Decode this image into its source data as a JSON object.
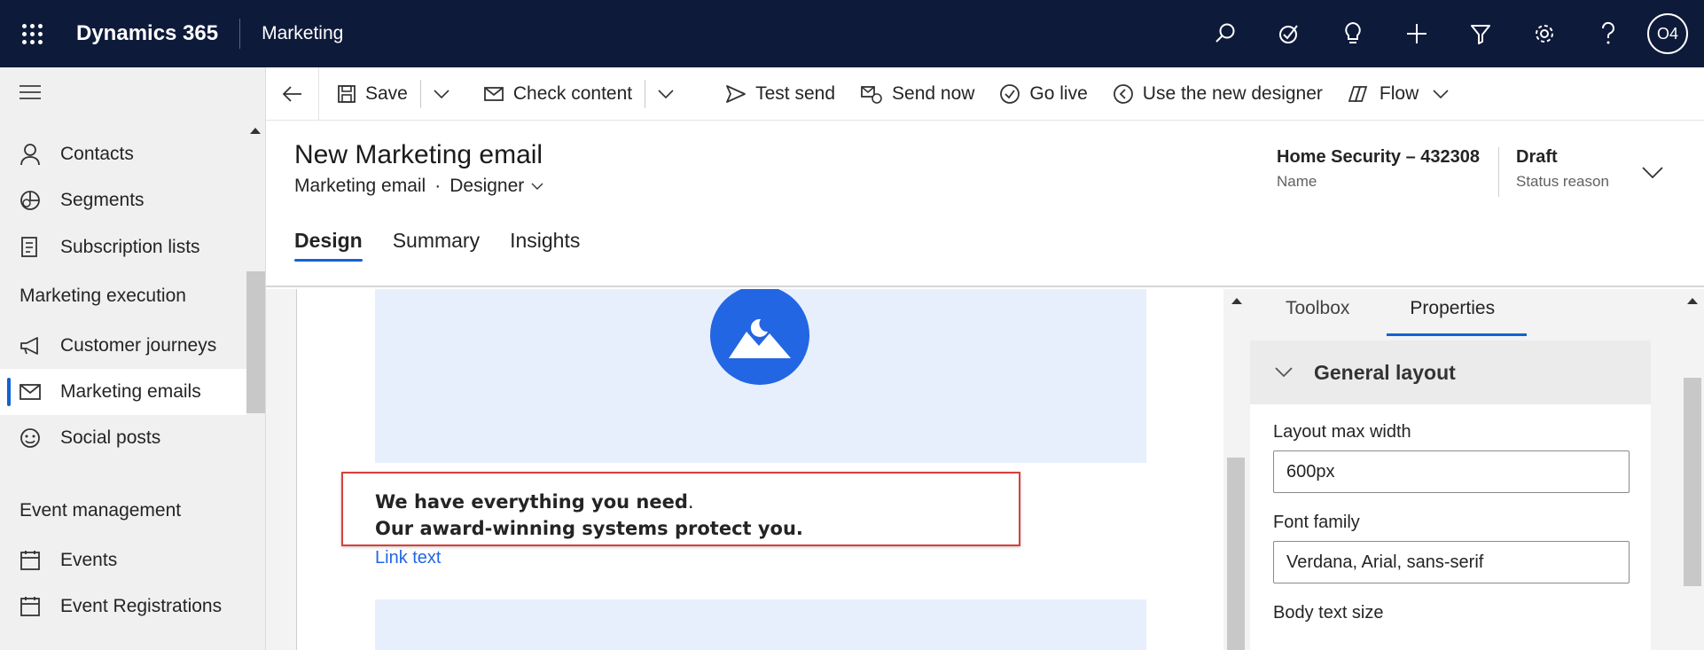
{
  "topbar": {
    "app_title": "Dynamics 365",
    "area": "Marketing",
    "icons": [
      "search-icon",
      "task-check-icon",
      "lightbulb-icon",
      "plus-icon",
      "filter-icon",
      "gear-icon",
      "help-icon"
    ],
    "avatar_initials": "O4",
    "colors": {
      "background": "#0e1a3a",
      "text": "#ffffff"
    }
  },
  "leftnav": {
    "items_top": [
      {
        "label": "Contacts",
        "icon": "person-icon"
      },
      {
        "label": "Segments",
        "icon": "segments-icon"
      },
      {
        "label": "Subscription lists",
        "icon": "subscription-list-icon"
      }
    ],
    "group1": {
      "title": "Marketing execution",
      "items": [
        {
          "label": "Customer journeys",
          "icon": "megaphone-icon"
        },
        {
          "label": "Marketing emails",
          "icon": "mail-icon",
          "active": true
        },
        {
          "label": "Social posts",
          "icon": "social-icon"
        }
      ]
    },
    "group2": {
      "title": "Event management",
      "items": [
        {
          "label": "Events",
          "icon": "calendar-icon"
        },
        {
          "label": "Event Registrations",
          "icon": "calendar-icon"
        }
      ]
    },
    "accent": "#1163d1"
  },
  "commandbar": {
    "save": "Save",
    "check_content": "Check content",
    "test_send": "Test send",
    "send_now": "Send now",
    "go_live": "Go live",
    "new_designer": "Use the new designer",
    "flow": "Flow"
  },
  "header": {
    "title": "New Marketing email",
    "entity": "Marketing email",
    "separator": "·",
    "form": "Designer",
    "name_value": "Home Security – 432308",
    "name_label": "Name",
    "status_value": "Draft",
    "status_label": "Status reason",
    "tabs": [
      "Design",
      "Summary",
      "Insights"
    ],
    "active_tab": "Design"
  },
  "canvas": {
    "text_line1_bold": "We have everything you need",
    "text_line1_end": ".",
    "text_line2": "Our award-winning systems protect you.",
    "link_text": "Link text",
    "image_placeholder_icon": "image-placeholder-icon",
    "placeholder_bg": "#e7effc",
    "highlight_color": "#d9403a"
  },
  "properties": {
    "tabs": [
      "Toolbox",
      "Properties"
    ],
    "active_tab": "Properties",
    "section": "General layout",
    "fields": [
      {
        "label": "Layout max width",
        "value": "600px"
      },
      {
        "label": "Font family",
        "value": "Verdana, Arial, sans-serif"
      },
      {
        "label": "Body text size"
      }
    ]
  }
}
